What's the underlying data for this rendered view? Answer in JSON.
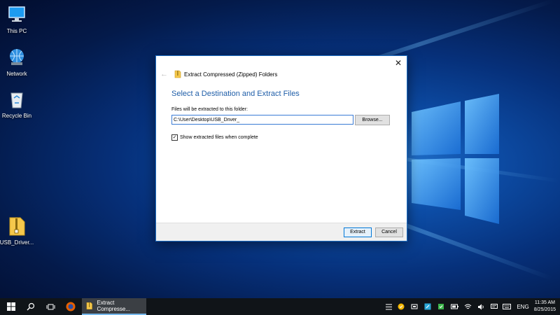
{
  "desktop": {
    "icons": [
      {
        "label": "This PC",
        "icon": "this-pc-icon"
      },
      {
        "label": "Network",
        "icon": "network-icon"
      },
      {
        "label": "Recycle Bin",
        "icon": "recycle-bin-icon"
      },
      {
        "label": "USB_Driver...",
        "icon": "zip-folder-icon"
      }
    ]
  },
  "dialog": {
    "title": "Extract Compressed (Zipped) Folders",
    "close_glyph": "✕",
    "back_glyph": "←",
    "heading": "Select a Destination and Extract Files",
    "path_label": "Files will be extracted to this folder:",
    "path_value": "C:\\User\\Desktop\\USB_Driver_",
    "browse_label": "Browse...",
    "checkbox_label": "Show extracted files when complete",
    "checkbox_checked": true,
    "checkbox_glyph": "✓",
    "extract_label": "Extract",
    "cancel_label": "Cancel"
  },
  "taskbar": {
    "active_app_label": "Extract Compresse...",
    "language": "ENG",
    "time": "11:35 AM",
    "date": "8/25/2015"
  },
  "colors": {
    "accent": "#0078d7",
    "heading": "#1f5ea8",
    "taskbar": "#101418"
  }
}
